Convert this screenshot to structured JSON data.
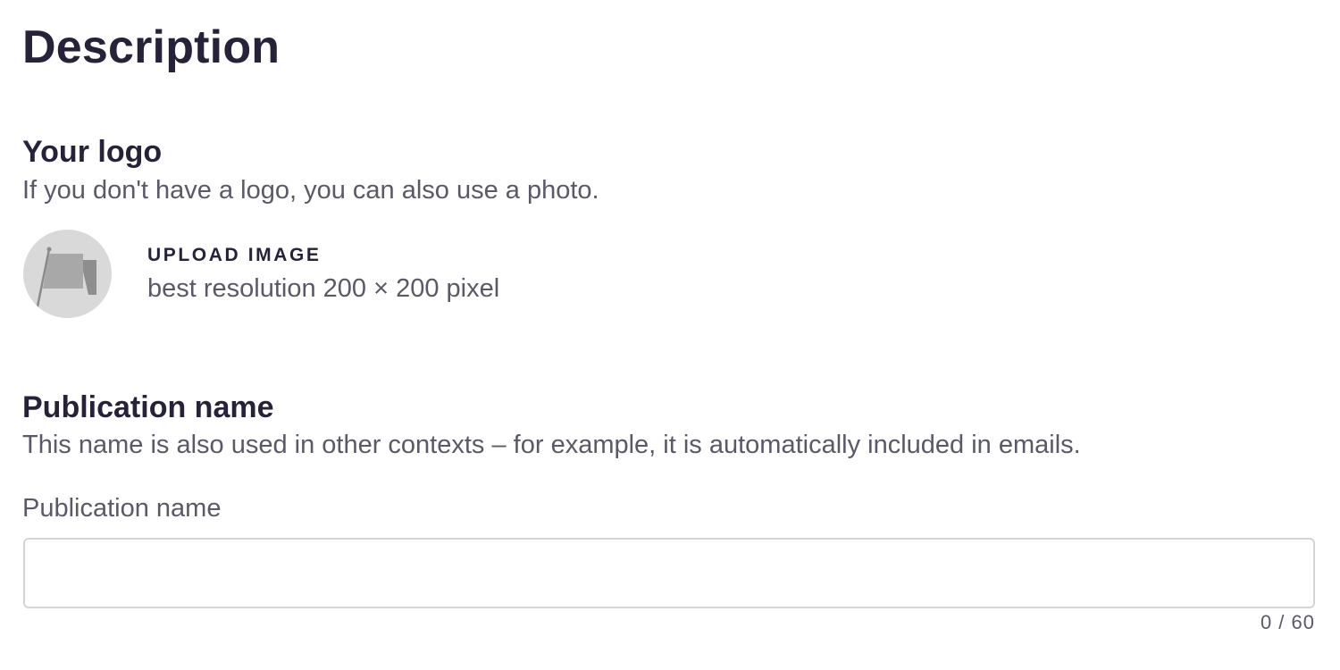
{
  "page": {
    "title": "Description"
  },
  "logo_section": {
    "title": "Your logo",
    "description": "If you don't have a logo, you can also use a photo.",
    "avatar_icon": "flag-icon",
    "upload_label": "UPLOAD IMAGE",
    "upload_hint": "best resolution 200 × 200 pixel"
  },
  "publication_section": {
    "title": "Publication name",
    "description": "This name is also used in other contexts – for example, it is automatically included in emails.",
    "field_label": "Publication name",
    "field_value": "",
    "field_placeholder": "",
    "counter": "0 / 60"
  },
  "colors": {
    "heading": "#27213a",
    "body_text": "#5c5868",
    "avatar_bg": "#d9d9d9",
    "input_border": "#d4d4d8"
  }
}
